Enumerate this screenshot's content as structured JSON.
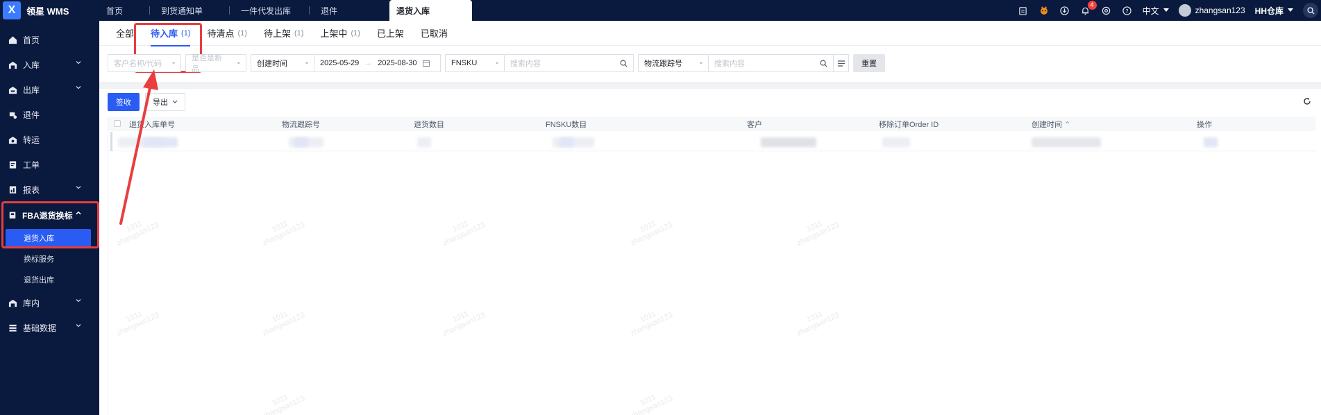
{
  "app": {
    "name": "领星 WMS",
    "logo_letter": "X"
  },
  "topbar": {
    "tabs": [
      {
        "label": "首页"
      },
      {
        "label": "到货通知单"
      },
      {
        "label": "一件代发出库"
      },
      {
        "label": "退件"
      },
      {
        "label": "退货入库",
        "active": true
      }
    ],
    "notification_count": "4",
    "language": "中文",
    "username": "zhangsan123",
    "warehouse": "HH仓库"
  },
  "sidebar": {
    "items": [
      {
        "label": "首页",
        "icon": "home-icon"
      },
      {
        "label": "入库",
        "icon": "inbound-icon",
        "expandable": true
      },
      {
        "label": "出库",
        "icon": "outbound-icon",
        "expandable": true
      },
      {
        "label": "退件",
        "icon": "return-icon"
      },
      {
        "label": "转运",
        "icon": "transfer-icon"
      },
      {
        "label": "工单",
        "icon": "ticket-icon"
      },
      {
        "label": "报表",
        "icon": "report-icon",
        "expandable": true
      }
    ],
    "group": {
      "label": "FBA退货换标",
      "sub_items": [
        {
          "label": "退货入库",
          "active": true
        },
        {
          "label": "换标服务"
        },
        {
          "label": "退货出库"
        }
      ]
    },
    "bottom_items": [
      {
        "label": "库内",
        "icon": "warehouse-icon",
        "expandable": true
      },
      {
        "label": "基础数据",
        "icon": "data-icon",
        "expandable": true
      }
    ]
  },
  "status_tabs": [
    {
      "label": "全部",
      "count": ""
    },
    {
      "label": "待入库",
      "count": "(1)",
      "active": true
    },
    {
      "label": "待清点",
      "count": "(1)"
    },
    {
      "label": "待上架",
      "count": "(1)"
    },
    {
      "label": "上架中",
      "count": "(1)"
    },
    {
      "label": "已上架",
      "count": ""
    },
    {
      "label": "已取消",
      "count": ""
    }
  ],
  "filters": {
    "customer_placeholder": "客户名称/代码",
    "is_new_placeholder": "是否是新品",
    "date_type": "创建时间",
    "date_start": "2025-05-29",
    "date_arrow": "→",
    "date_end": "2025-08-30",
    "fnsku_label": "FNSKU",
    "search_placeholder": "搜索内容",
    "tracking_label": "物流跟踪号",
    "search_placeholder2": "搜索内容",
    "reset_label": "重置"
  },
  "actions": {
    "sign_label": "签收",
    "export_label": "导出"
  },
  "table": {
    "columns": [
      "退货入库单号",
      "物流跟踪号",
      "退货数目",
      "FNSKU数目",
      "客户",
      "移除订单Order ID",
      "创建时间",
      "操作"
    ]
  },
  "watermark": {
    "line1": "1011",
    "line2": "zhangsan123"
  },
  "colors": {
    "nav_bg": "#0a1a3e",
    "primary": "#2a5cf4",
    "annotation": "#e83e3e"
  }
}
